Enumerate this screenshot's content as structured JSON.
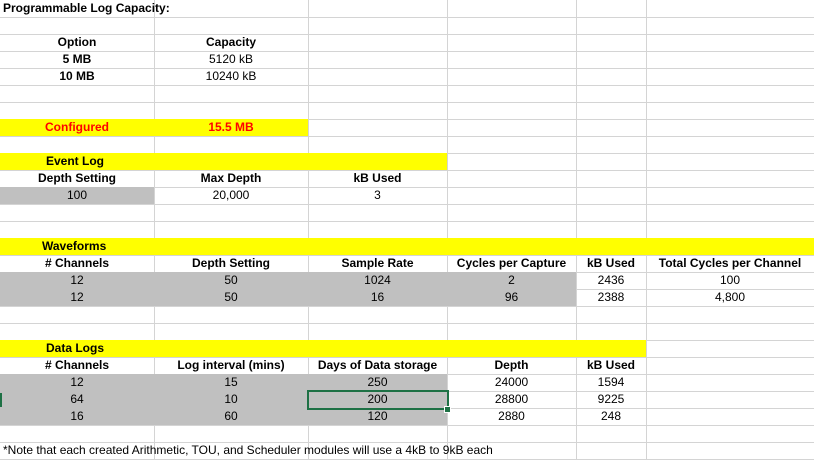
{
  "title": "Programmable Log Capacity:",
  "capacity": {
    "headers": [
      "Option",
      "Capacity"
    ],
    "rows": [
      [
        "5 MB",
        "5120 kB"
      ],
      [
        "10 MB",
        "10240 kB"
      ]
    ]
  },
  "configured": {
    "label": "Configured",
    "value": "15.5 MB"
  },
  "event_log": {
    "title": "Event Log",
    "headers": [
      "Depth Setting",
      "Max Depth",
      "kB Used"
    ],
    "row": [
      "100",
      "20,000",
      "3"
    ]
  },
  "waveforms": {
    "title": "Waveforms",
    "headers": [
      "# Channels",
      "Depth Setting",
      "Sample Rate",
      "Cycles per Capture",
      "kB Used",
      "Total Cycles per Channel"
    ],
    "rows": [
      [
        "12",
        "50",
        "1024",
        "2",
        "2436",
        "100"
      ],
      [
        "12",
        "50",
        "16",
        "96",
        "2388",
        "4,800"
      ]
    ]
  },
  "data_logs": {
    "title": "Data Logs",
    "headers": [
      "# Channels",
      "Log interval (mins)",
      "Days of Data storage",
      "Depth",
      "kB Used"
    ],
    "rows": [
      [
        "12",
        "15",
        "250",
        "24000",
        "1594"
      ],
      [
        "64",
        "10",
        "200",
        "28800",
        "9225"
      ],
      [
        "16",
        "60",
        "120",
        "2880",
        "248"
      ]
    ]
  },
  "note": "*Note that each created Arithmetic, TOU, and Scheduler modules will use a 4kB to 9kB each",
  "colors": {
    "highlight": "#ffff00",
    "input_gray": "#c0c0c0",
    "configured_red": "#ff0000",
    "selection": "#1e7145"
  }
}
